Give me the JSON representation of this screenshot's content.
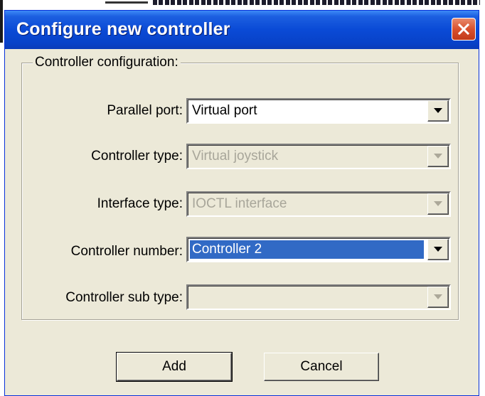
{
  "dialog": {
    "title": "Configure new controller"
  },
  "group": {
    "label": "Controller configuration:"
  },
  "fields": {
    "parallel_port": {
      "label": "Parallel port:",
      "value": "Virtual port",
      "enabled": true
    },
    "controller_type": {
      "label": "Controller type:",
      "value": "Virtual joystick",
      "enabled": false
    },
    "interface_type": {
      "label": "Interface type:",
      "value": "IOCTL interface",
      "enabled": false
    },
    "controller_number": {
      "label": "Controller number:",
      "value": "Controller 2",
      "enabled": true,
      "selected": true
    },
    "controller_sub_type": {
      "label": "Controller sub type:",
      "value": "",
      "enabled": false
    }
  },
  "buttons": {
    "add_label": "Add",
    "cancel_label": "Cancel"
  },
  "colors": {
    "titlebar": "#0a4ad6",
    "dialog_bg": "#ece9d8",
    "selection": "#316ac5",
    "close_button": "#d9512e"
  },
  "icons": {
    "close": "close-icon",
    "dropdown": "chevron-down-icon"
  }
}
